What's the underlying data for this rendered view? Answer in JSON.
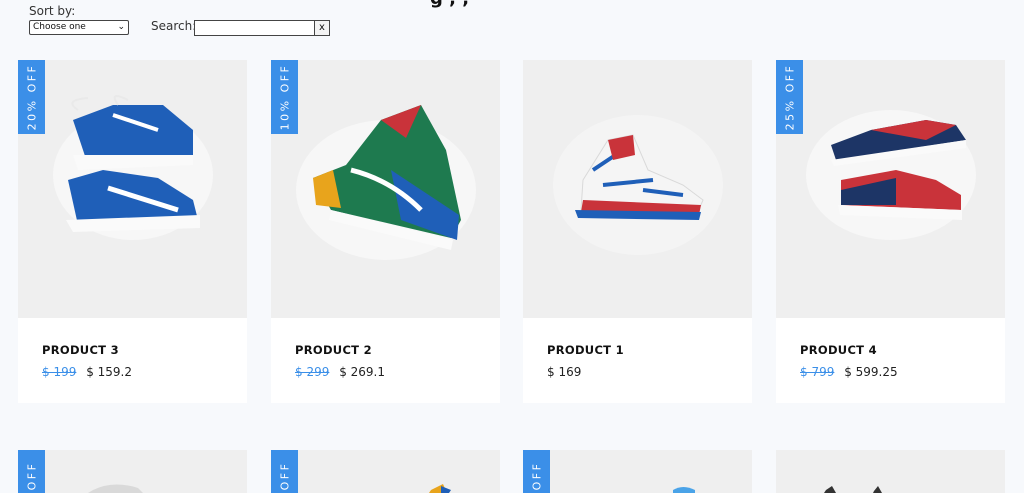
{
  "header": {
    "partial_title": "g         ,  ,  "
  },
  "controls": {
    "sort_label": "Sort by:",
    "sort_selected": "Choose one",
    "search_label": "Search:",
    "search_value": "",
    "clear_label": "x"
  },
  "colors": {
    "accent": "#3b8fe8",
    "card_image_bg": "#efefef",
    "page_bg": "#f7f9fc"
  },
  "products": [
    {
      "name": "PRODUCT 3",
      "badge": "20% OFF",
      "old_price": "$ 199",
      "price": "$ 159.2",
      "image": "blue-white-high-top-sneakers"
    },
    {
      "name": "PRODUCT 2",
      "badge": "10% OFF",
      "old_price": "$ 299",
      "price": "$ 269.1",
      "image": "green-blue-yellow-sneaker"
    },
    {
      "name": "PRODUCT 1",
      "badge": "",
      "old_price": "",
      "price": "$ 169",
      "image": "red-blue-white-running-shoes"
    },
    {
      "name": "PRODUCT 4",
      "badge": "25% OFF",
      "old_price": "$ 799",
      "price": "$ 599.25",
      "image": "navy-red-sneakers"
    }
  ],
  "second_row_badges": [
    "OFF",
    "OFF",
    "OFF"
  ]
}
